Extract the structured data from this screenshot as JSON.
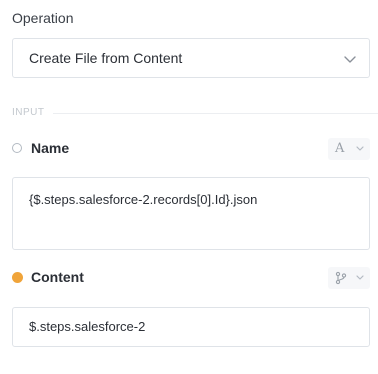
{
  "operation": {
    "label": "Operation",
    "selected_value": "Create File from Content",
    "chevron_icon": "chevron-down-icon"
  },
  "section": {
    "title": "INPUT"
  },
  "fields": {
    "name": {
      "label": "Name",
      "status": "empty",
      "type_glyph": "A",
      "type_icon": "text-type-icon",
      "value": "{$.steps.salesforce-2.records[0].Id}.json"
    },
    "content": {
      "label": "Content",
      "status": "filled",
      "status_color": "#f0a43a",
      "type_icon": "branch-icon",
      "value": "$.steps.salesforce-2"
    }
  }
}
